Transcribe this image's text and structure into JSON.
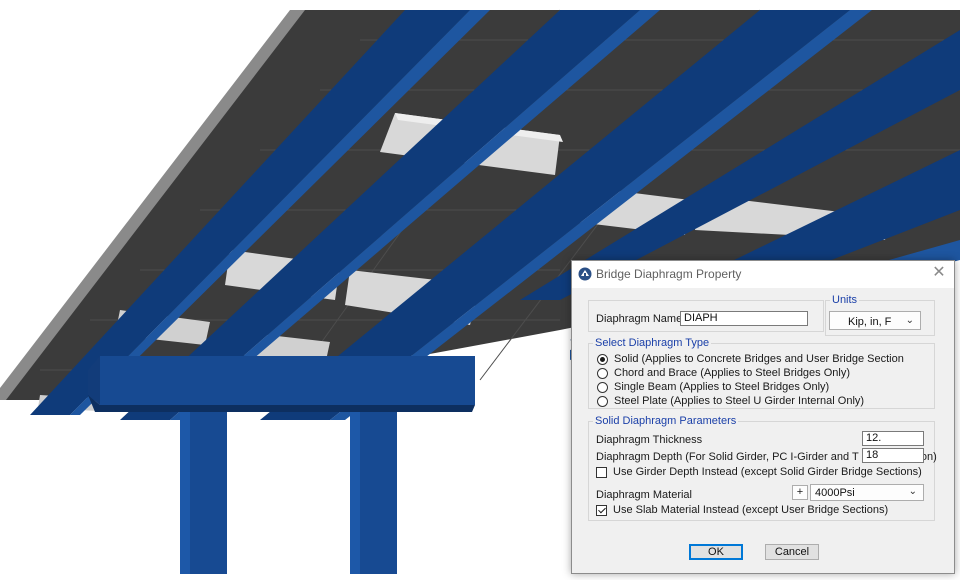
{
  "dialog": {
    "title": "Bridge Diaphragm Property",
    "close_glyph": "✕",
    "app_icon": "bridge-app-icon"
  },
  "name_section": {
    "label": "Diaphragm Name",
    "value": "DIAPH"
  },
  "units": {
    "legend": "Units",
    "selected": "Kip, in, F"
  },
  "type_section": {
    "legend": "Select Diaphragm Type",
    "options": [
      {
        "label": "Solid   (Applies to Concrete Bridges and User Bridge Section",
        "selected": true
      },
      {
        "label": "Chord and Brace   (Applies to Steel Bridges Only)",
        "selected": false
      },
      {
        "label": "Single Beam   (Applies to Steel Bridges Only)",
        "selected": false
      },
      {
        "label": "Steel Plate   (Applies to Steel U Girder Internal Only)",
        "selected": false
      }
    ]
  },
  "params_section": {
    "legend": "Solid Diaphragm Parameters",
    "thickness_label": "Diaphragm Thickness",
    "thickness_value": "12.",
    "depth_label": "Diaphragm Depth (For Solid Girder, PC I-Girder and T Bridge Section)",
    "depth_value": "18",
    "girder_depth_label": "Use Girder Depth Instead (except Solid Girder Bridge Sections)",
    "girder_depth_checked": false,
    "material_label": "Diaphragm Material",
    "material_plus": "+",
    "material_value": "4000Psi",
    "slab_material_label": "Use Slab Material Instead (except User Bridge Sections)",
    "slab_material_checked": true
  },
  "buttons": {
    "ok": "OK",
    "cancel": "Cancel"
  },
  "colors": {
    "girder_blue": "#0e3a78",
    "deck_dark": "#3a3a3a",
    "diaphragm_light": "#d6d6d6",
    "legend_blue": "#1a3fa8"
  }
}
